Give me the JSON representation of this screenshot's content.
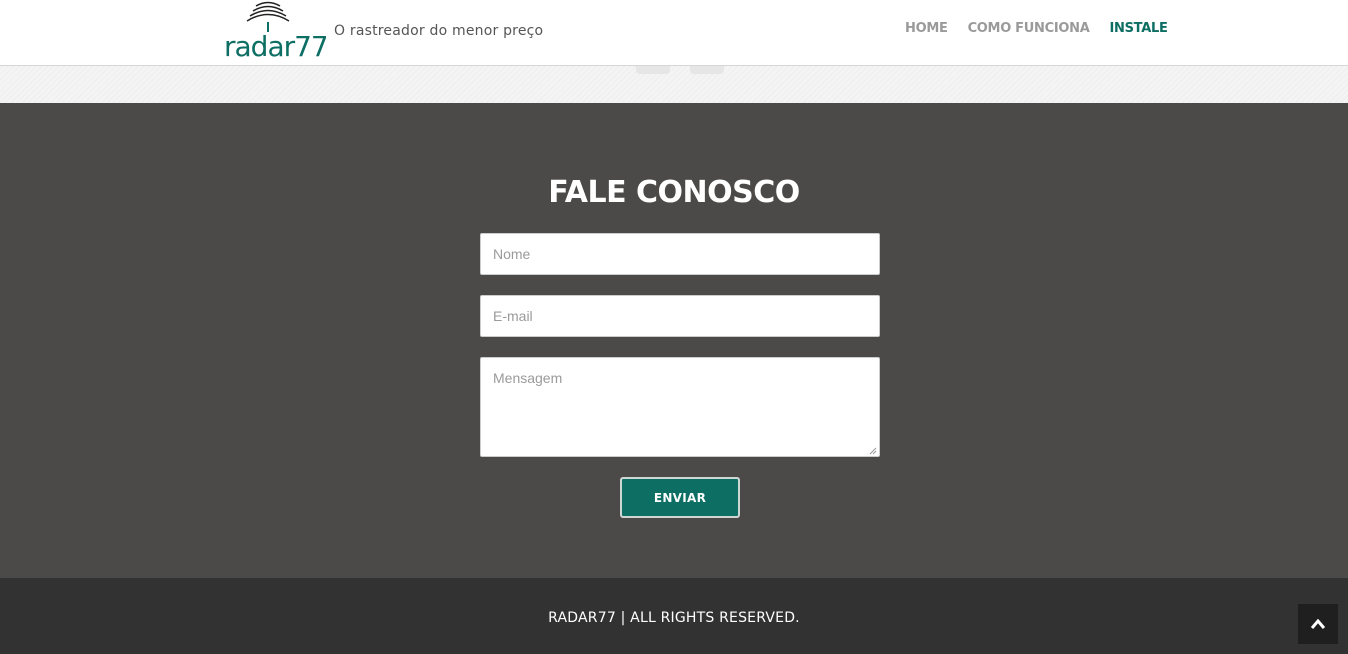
{
  "header": {
    "logo_text": "radar77",
    "tagline": "O rastreador do menor preço",
    "nav": [
      {
        "label": "HOME",
        "active": false
      },
      {
        "label": "COMO FUNCIONA",
        "active": false
      },
      {
        "label": "INSTALE",
        "active": true
      }
    ]
  },
  "social": {
    "icons": [
      "facebook-icon",
      "twitter-icon"
    ]
  },
  "contact": {
    "title": "FALE CONOSCO",
    "name_placeholder": "Nome",
    "email_placeholder": "E-mail",
    "message_placeholder": "Mensagem",
    "submit_label": "ENVIAR"
  },
  "footer": {
    "text": "RADAR77 | ALL RIGHTS RESERVED."
  },
  "colors": {
    "brand": "#0d6e63",
    "contact_bg": "#4b4a48",
    "footer_bg": "#323232"
  }
}
